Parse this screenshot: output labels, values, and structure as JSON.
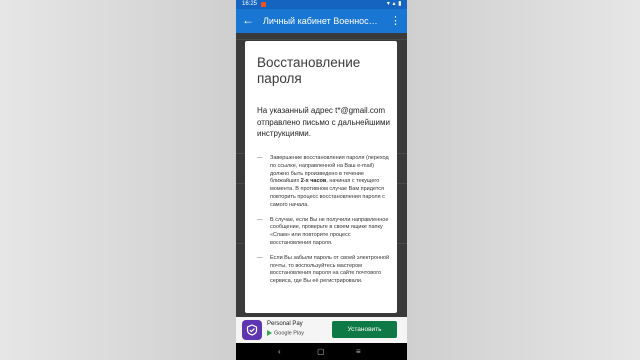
{
  "statusbar": {
    "time": "16:25",
    "right_icons": "▾ ▴ ▮"
  },
  "appbar": {
    "back_icon": "arrow-back-icon",
    "title": "Личный кабинет Военнослуж...",
    "menu_icon": "more-vert-icon"
  },
  "dialog": {
    "title": "Восстановление пароля",
    "message": "На указанный адрес t*@gmail.com отправлено письмо с дальнейшими инструкциями.",
    "notes": [
      {
        "dash": "—",
        "before": "Завершение восстановления пароля (переход по ссылке, направленной на Ваш e-mail) должно быть произведено в течение ближайших ",
        "bold": "2-х часов",
        "after": ", начиная с текущего момента. В противном случае Вам придется повторить процесс восстановления пароля с самого начала."
      },
      {
        "dash": "—",
        "text": "В случае, если Вы не получили направленное сообщение, проверьте в своем ящике папку «Спам» или повторите процесс восстановления пароля."
      },
      {
        "dash": "—",
        "text": "Если Вы забыли пароль от своей электронной почты, то воспользуйтесь мастером восстановления пароля на сайте почтового сервиса, где Вы её регистрировали."
      }
    ]
  },
  "ad": {
    "app_name": "Personal Pay",
    "store_label": "Google Play",
    "install_label": "Установить",
    "logo_color": "#5e35b1",
    "button_color": "#0d7a45"
  },
  "navbar": {
    "back": "‹",
    "home": "▢",
    "recents": "≡"
  },
  "colors": {
    "statusbar": "#1565c0",
    "appbar": "#1976d2"
  }
}
